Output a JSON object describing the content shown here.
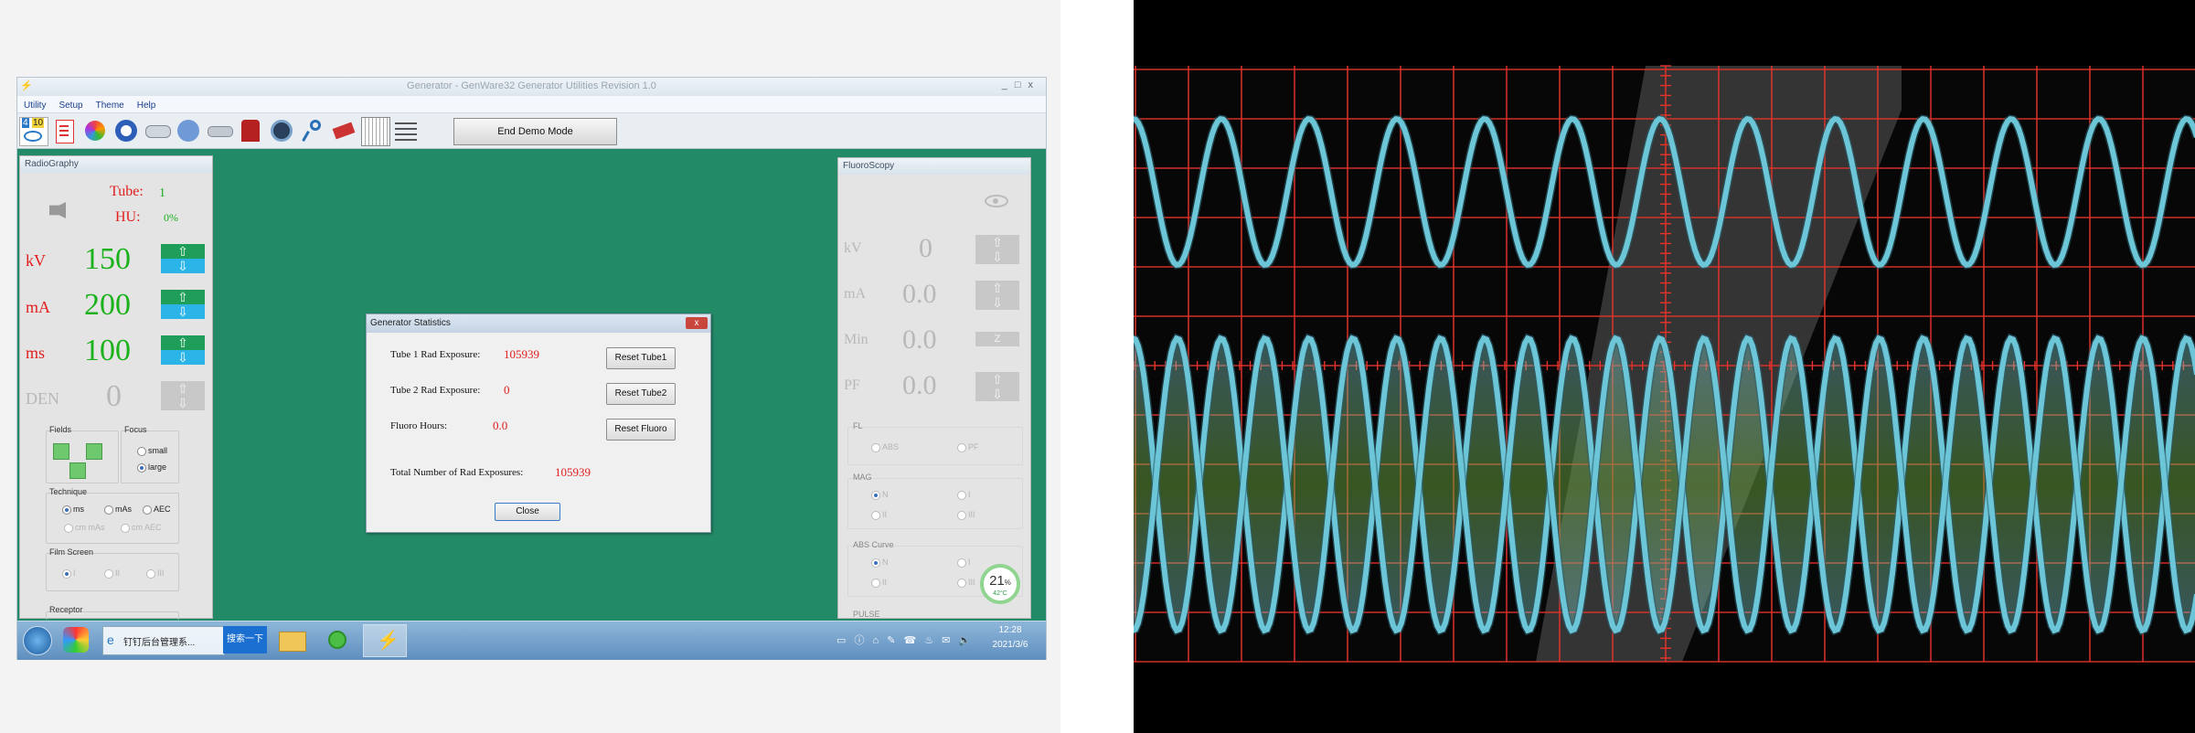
{
  "window": {
    "title": "Generator - GenWare32 Generator Utilities Revision 1.0",
    "controls": [
      "_",
      "□",
      "x"
    ]
  },
  "menu": [
    "Utility",
    "Setup",
    "Theme",
    "Help"
  ],
  "toolbar": {
    "icons": [
      "counter-icon",
      "document-icon",
      "palette-icon",
      "radiation-icon",
      "tube-icon",
      "waveform-icon",
      "bar-icon",
      "lens-icon",
      "probe-icon",
      "ruler-icon",
      "monitor-icon",
      "grid-icon",
      "chart-icon"
    ],
    "icon_digits": [
      "4",
      "10"
    ],
    "demo_button": "End Demo Mode"
  },
  "radiography": {
    "header": "RadioGraphy",
    "tube_label": "Tube:",
    "tube_value": "1",
    "hu_label": "HU:",
    "hu_value": "0%",
    "kv_label": "kV",
    "kv_value": "150",
    "ma_label": "mA",
    "ma_value": "200",
    "ms_label": "ms",
    "ms_value": "100",
    "den_label": "DEN",
    "den_value": "0",
    "fields_label": "Fields",
    "focus_label": "Focus",
    "focus_small": "small",
    "focus_large": "large",
    "technique_label": "Technique",
    "tech_ms": "ms",
    "tech_mas": "mAs",
    "tech_aec": "AEC",
    "tech_cm_mas": "cm mAs",
    "tech_cm_aec": "cm AEC",
    "film_screen_label": "Film Screen",
    "fs_1": "I",
    "fs_2": "II",
    "fs_3": "III",
    "receptor_label": "Receptor"
  },
  "fluoroscopy": {
    "header": "FluoroScopy",
    "kv_label": "kV",
    "kv_value": "0",
    "ma_label": "mA",
    "ma_value": "0.0",
    "min_label": "Min",
    "min_value": "0.0",
    "pf_label": "PF",
    "pf_value": "0.0",
    "fl_label": "FL",
    "fl_abs": "ABS",
    "fl_pf": "PF",
    "mag_label": "MAG",
    "mag_n": "N",
    "mag_i": "I",
    "mag_ii": "II",
    "mag_iii": "III",
    "abs_curve_label": "ABS Curve",
    "ac_n": "N",
    "ac_i": "I",
    "ac_ii": "II",
    "ac_iii": "III",
    "pulse_label": "PULSE"
  },
  "dialog": {
    "title": "Generator Statistics",
    "close_x": "x",
    "tube1_label": "Tube 1 Rad Exposure:",
    "tube1_value": "105939",
    "tube2_label": "Tube 2 Rad Exposure:",
    "tube2_value": "0",
    "fluoro_label": "Fluoro Hours:",
    "fluoro_value": "0.0",
    "total_label": "Total Number of Rad Exposures:",
    "total_value": "105939",
    "reset_tube1": "Reset Tube1",
    "reset_tube2": "Reset Tube2",
    "reset_fluoro": "Reset Fluoro",
    "close": "Close"
  },
  "gauge": {
    "percent": "21",
    "unit": "%",
    "temp": "42°C"
  },
  "taskbar": {
    "task1_label": "钉钉后台管理系...",
    "search_label": "搜索一下",
    "time": "12:28",
    "date": "2021/3/6"
  },
  "colors": {
    "desk": "#238a68",
    "value_green": "#1bb11b",
    "value_red": "#e21d1d",
    "scope_grid": "#e8322a",
    "scope_trace": "#6cc6d8",
    "scope_fill": "#6aa63a"
  }
}
